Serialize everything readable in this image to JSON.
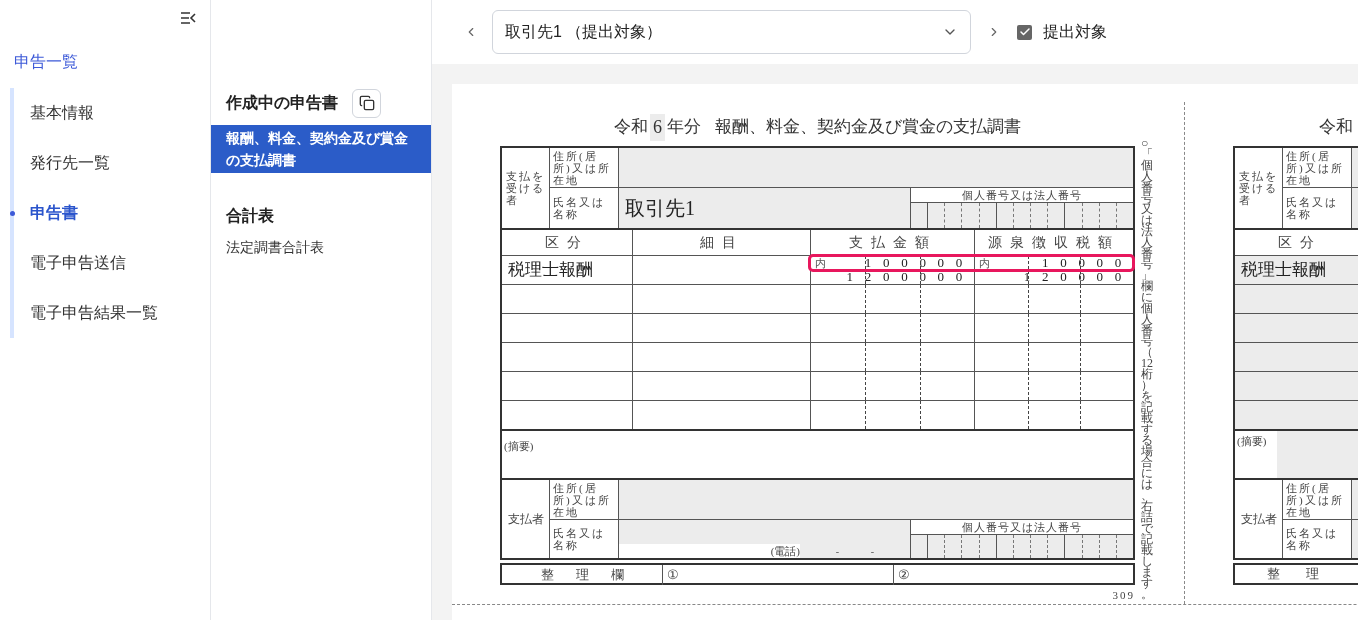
{
  "sidebar": {
    "back_link": "申告一覧",
    "items": [
      {
        "label": "基本情報",
        "selected": false
      },
      {
        "label": "発行先一覧",
        "selected": false
      },
      {
        "label": "申告書",
        "selected": true
      },
      {
        "label": "電子申告送信",
        "selected": false
      },
      {
        "label": "電子申告結果一覧",
        "selected": false
      }
    ]
  },
  "document_panel": {
    "sections": [
      {
        "title": "作成中の申告書",
        "kind": "copyable",
        "items": [
          {
            "label": "報酬、料金、契約金及び賞金の支払調書",
            "selected": true
          }
        ]
      },
      {
        "title": "合計表",
        "kind": "plain",
        "items": [
          {
            "label": "法定調書合計表",
            "selected": false
          }
        ]
      }
    ]
  },
  "toolbar": {
    "recipient_select": "取引先1 （提出対象）",
    "submission_target": {
      "label": "提出対象",
      "checked": true
    }
  },
  "form": {
    "era_label": "令和",
    "year": "6",
    "year_suffix": "年分",
    "title": "報酬、料金、契約金及び賞金の支払調書",
    "recipient": {
      "label": "支払を受ける者",
      "address_label": "住所(居所)又は所在地",
      "name_label": "氏名又は名称",
      "name": "取引先1",
      "number_label": "個人番号又は法人番号"
    },
    "columns": [
      "区分",
      "細目",
      "支払金額",
      "源泉徴収税額"
    ],
    "rows": [
      {
        "category": "税理士報酬",
        "payment_inner_mark": "内",
        "payment_inner": "100000",
        "payment": "1200000",
        "tax_inner_mark": "内",
        "tax_inner": "10000",
        "tax": "120000",
        "highlighted": true
      }
    ],
    "summary_label": "(摘要)",
    "payer": {
      "label": "支払者",
      "address_label": "住所(居所)又は所在地",
      "name_label": "氏名又は名称",
      "phone_label": "(電話)",
      "phone_separators": [
        "-",
        "-"
      ],
      "number_label": "個人番号又は法人番号"
    },
    "reference": {
      "label": "整理欄",
      "first": "①",
      "second": "②"
    },
    "form_number": "309",
    "note": "○「個人番号又は法人番号」欄に個人番号（12桁）を記載する場合には、右詰で記載します。"
  },
  "next_copy": {
    "era_label": "令和",
    "recipient_label": "支払を受ける者",
    "address_label": "住所(居所)又は所在地",
    "name_label": "氏名又は名称",
    "column": "区分",
    "category": "税理士報酬",
    "summary_label": "(摘要)",
    "payer_label": "支払者",
    "payer_address_label": "住所(居所)又は所在地",
    "payer_name_label": "氏名又は名称",
    "reference_label": "整　　理"
  }
}
